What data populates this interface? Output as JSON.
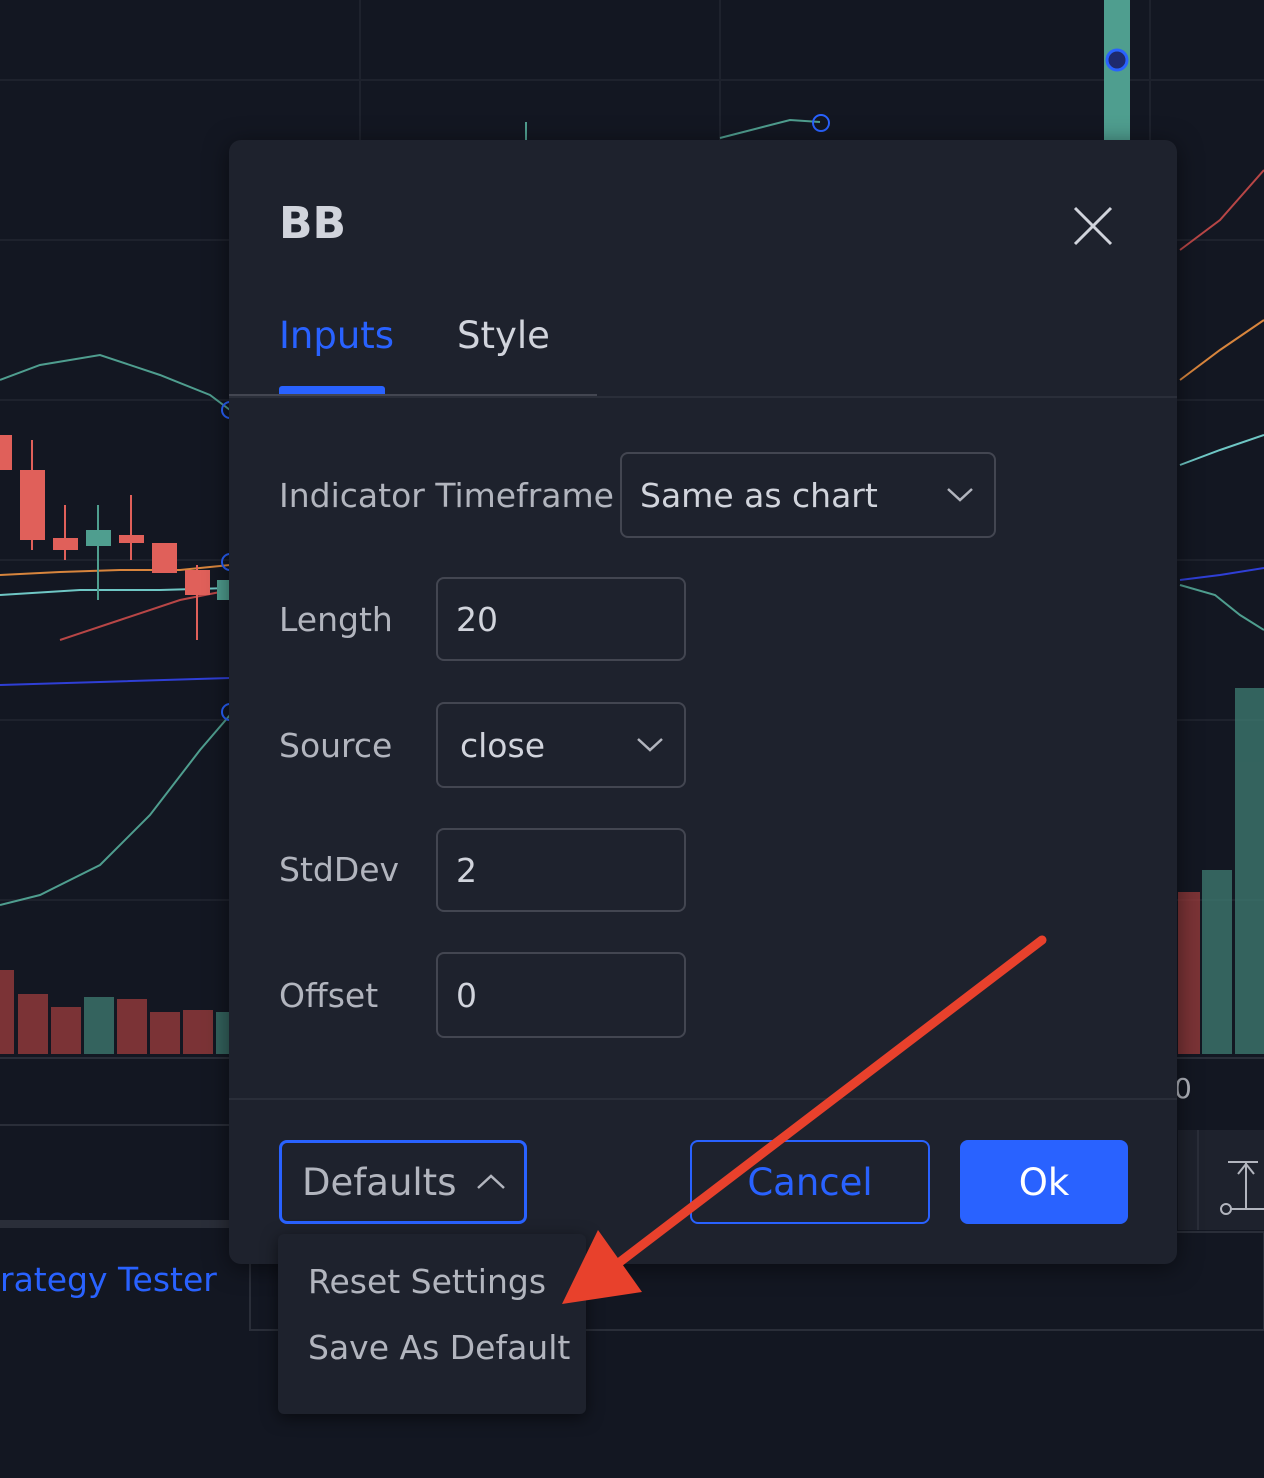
{
  "dialog": {
    "title": "BB",
    "tabs": [
      {
        "label": "Inputs",
        "active": true
      },
      {
        "label": "Style",
        "active": false
      }
    ],
    "fields": {
      "timeframe": {
        "label": "Indicator Timeframe",
        "value": "Same as chart"
      },
      "length": {
        "label": "Length",
        "value": "20"
      },
      "source": {
        "label": "Source",
        "value": "close"
      },
      "stddev": {
        "label": "StdDev",
        "value": "2"
      },
      "offset": {
        "label": "Offset",
        "value": "0"
      }
    },
    "footer": {
      "defaults_label": "Defaults",
      "cancel_label": "Cancel",
      "ok_label": "Ok"
    }
  },
  "defaults_menu": {
    "items": [
      "Reset Settings",
      "Save As Default"
    ]
  },
  "background": {
    "strategy_tab_fragment": "rategy Tester",
    "axis_fragment": "0"
  },
  "colors": {
    "accent": "#2962ff",
    "annotation_arrow": "#e8412c",
    "bull": "#4f9e8f",
    "bear": "#e0605a"
  },
  "icons": [
    "close-icon",
    "chevron-down-icon",
    "chevron-up-icon"
  ]
}
